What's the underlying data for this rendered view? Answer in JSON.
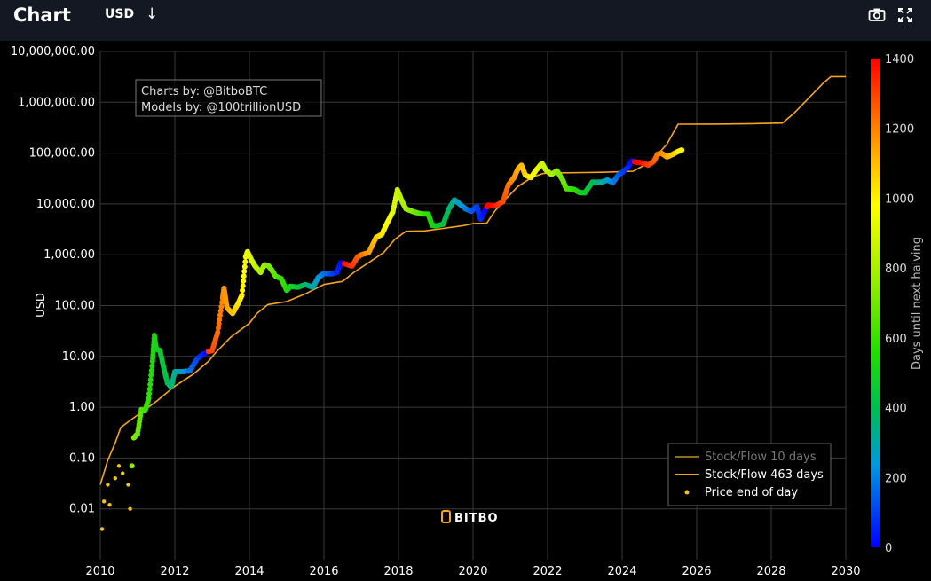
{
  "header": {
    "title": "Chart",
    "currency": "USD",
    "currency_arrow": "↓",
    "icons": [
      "camera-icon",
      "fullscreen-icon"
    ]
  },
  "credits": {
    "line1": "Charts by: @BitboBTC",
    "line2": "Models by: @100trillionUSD"
  },
  "watermark": "BITBO",
  "colors": {
    "background": "#000000",
    "topbar": "#141823",
    "grid": "#3a3a3a",
    "sf10": "#8a6d1f",
    "sf463": "#f7a51c",
    "price_dot": "#f7c21c"
  },
  "chart_data": {
    "type": "scatter",
    "ylabel": "USD",
    "yscale": "log",
    "ylim": [
      0.001,
      10000000
    ],
    "xlim": [
      2010,
      2030
    ],
    "y_ticks": [
      {
        "v": 10000000,
        "label": "10,000,000.00"
      },
      {
        "v": 1000000,
        "label": "1,000,000.00"
      },
      {
        "v": 100000,
        "label": "100,000.00"
      },
      {
        "v": 10000,
        "label": "10,000.00"
      },
      {
        "v": 1000,
        "label": "1,000.00"
      },
      {
        "v": 100,
        "label": "100.00"
      },
      {
        "v": 10,
        "label": "10.00"
      },
      {
        "v": 1,
        "label": "1.00"
      },
      {
        "v": 0.1,
        "label": "0.10"
      },
      {
        "v": 0.01,
        "label": "0.01"
      }
    ],
    "x_ticks": [
      "2010",
      "2012",
      "2014",
      "2016",
      "2018",
      "2020",
      "2022",
      "2024",
      "2026",
      "2028",
      "2030"
    ],
    "colorbar": {
      "label": "Days until next halving",
      "min": 0,
      "max": 1400,
      "ticks": [
        "0",
        "200",
        "400",
        "600",
        "800",
        "1000",
        "1200",
        "1400"
      ]
    },
    "legend": {
      "position": "bottom-right",
      "items": [
        {
          "name": "Stock/Flow 10 days",
          "kind": "line-dim"
        },
        {
          "name": "Stock/Flow 463 days",
          "kind": "line"
        },
        {
          "name": "Price end of day",
          "kind": "dot"
        }
      ]
    },
    "halvings": [
      2009.0,
      2012.9,
      2016.53,
      2020.37,
      2024.31,
      2028.3,
      2032.3
    ],
    "series": [
      {
        "name": "Stock/Flow 463 days",
        "points": [
          [
            2010.0,
            0.03
          ],
          [
            2010.2,
            0.09
          ],
          [
            2010.4,
            0.2
          ],
          [
            2010.55,
            0.4
          ],
          [
            2010.8,
            0.55
          ],
          [
            2011.0,
            0.7
          ],
          [
            2011.5,
            1.3
          ],
          [
            2012.0,
            2.6
          ],
          [
            2012.5,
            4.5
          ],
          [
            2012.9,
            8
          ],
          [
            2013.1,
            12
          ],
          [
            2013.5,
            24
          ],
          [
            2014.0,
            45
          ],
          [
            2014.2,
            70
          ],
          [
            2014.5,
            105
          ],
          [
            2015.0,
            120
          ],
          [
            2015.5,
            170
          ],
          [
            2016.0,
            260
          ],
          [
            2016.5,
            300
          ],
          [
            2016.8,
            450
          ],
          [
            2017.2,
            700
          ],
          [
            2017.6,
            1100
          ],
          [
            2017.9,
            2000
          ],
          [
            2018.2,
            2900
          ],
          [
            2018.7,
            2950
          ],
          [
            2019.2,
            3300
          ],
          [
            2019.7,
            3700
          ],
          [
            2020.0,
            4100
          ],
          [
            2020.37,
            4200
          ],
          [
            2020.6,
            7500
          ],
          [
            2020.9,
            13000
          ],
          [
            2021.2,
            22000
          ],
          [
            2021.6,
            34000
          ],
          [
            2021.9,
            40000
          ],
          [
            2022.4,
            41000
          ],
          [
            2023.0,
            41500
          ],
          [
            2023.5,
            42000
          ],
          [
            2024.3,
            44000
          ],
          [
            2024.8,
            70000
          ],
          [
            2025.2,
            150000
          ],
          [
            2025.5,
            370000
          ],
          [
            2026.5,
            372000
          ],
          [
            2027.5,
            380000
          ],
          [
            2028.3,
            390000
          ],
          [
            2028.6,
            600000
          ],
          [
            2029.0,
            1200000
          ],
          [
            2029.4,
            2400000
          ],
          [
            2029.6,
            3200000
          ],
          [
            2030.0,
            3200000
          ]
        ]
      },
      {
        "name": "Price end of day",
        "points": [
          [
            2010.05,
            0.004
          ],
          [
            2010.1,
            0.014
          ],
          [
            2010.2,
            0.03
          ],
          [
            2010.25,
            0.012
          ],
          [
            2010.4,
            0.04
          ],
          [
            2010.5,
            0.07
          ],
          [
            2010.6,
            0.05
          ],
          [
            2010.75,
            0.03
          ],
          [
            2010.8,
            0.01
          ],
          [
            2010.85,
            0.07
          ],
          [
            2010.9,
            0.25
          ],
          [
            2011.0,
            0.3
          ],
          [
            2011.1,
            0.9
          ],
          [
            2011.2,
            0.85
          ],
          [
            2011.3,
            1.5
          ],
          [
            2011.4,
            8
          ],
          [
            2011.45,
            26
          ],
          [
            2011.5,
            14
          ],
          [
            2011.6,
            13
          ],
          [
            2011.7,
            6
          ],
          [
            2011.8,
            3
          ],
          [
            2011.9,
            2.5
          ],
          [
            2012.0,
            5
          ],
          [
            2012.2,
            5
          ],
          [
            2012.4,
            5.2
          ],
          [
            2012.6,
            9
          ],
          [
            2012.75,
            11
          ],
          [
            2012.9,
            12.5
          ],
          [
            2013.0,
            13
          ],
          [
            2013.15,
            30
          ],
          [
            2013.28,
            140
          ],
          [
            2013.32,
            220
          ],
          [
            2013.4,
            90
          ],
          [
            2013.55,
            70
          ],
          [
            2013.7,
            110
          ],
          [
            2013.8,
            160
          ],
          [
            2013.9,
            900
          ],
          [
            2013.95,
            1150
          ],
          [
            2014.05,
            800
          ],
          [
            2014.15,
            600
          ],
          [
            2014.3,
            450
          ],
          [
            2014.4,
            630
          ],
          [
            2014.5,
            620
          ],
          [
            2014.6,
            500
          ],
          [
            2014.7,
            380
          ],
          [
            2014.85,
            340
          ],
          [
            2015.0,
            200
          ],
          [
            2015.1,
            240
          ],
          [
            2015.3,
            230
          ],
          [
            2015.5,
            260
          ],
          [
            2015.7,
            230
          ],
          [
            2015.85,
            360
          ],
          [
            2016.0,
            430
          ],
          [
            2016.2,
            420
          ],
          [
            2016.35,
            450
          ],
          [
            2016.45,
            700
          ],
          [
            2016.6,
            650
          ],
          [
            2016.75,
            600
          ],
          [
            2016.9,
            900
          ],
          [
            2017.0,
            1000
          ],
          [
            2017.2,
            1100
          ],
          [
            2017.4,
            2200
          ],
          [
            2017.55,
            2500
          ],
          [
            2017.7,
            4300
          ],
          [
            2017.85,
            7000
          ],
          [
            2017.97,
            19000
          ],
          [
            2018.1,
            11000
          ],
          [
            2018.2,
            8000
          ],
          [
            2018.4,
            7000
          ],
          [
            2018.6,
            6400
          ],
          [
            2018.8,
            6300
          ],
          [
            2018.9,
            3800
          ],
          [
            2019.0,
            3700
          ],
          [
            2019.2,
            4000
          ],
          [
            2019.35,
            8000
          ],
          [
            2019.5,
            12000
          ],
          [
            2019.6,
            10500
          ],
          [
            2019.8,
            8000
          ],
          [
            2019.95,
            7200
          ],
          [
            2020.1,
            9000
          ],
          [
            2020.2,
            5000
          ],
          [
            2020.3,
            7000
          ],
          [
            2020.4,
            9500
          ],
          [
            2020.6,
            9200
          ],
          [
            2020.8,
            11000
          ],
          [
            2020.95,
            24000
          ],
          [
            2021.1,
            33000
          ],
          [
            2021.2,
            48000
          ],
          [
            2021.3,
            58000
          ],
          [
            2021.4,
            37000
          ],
          [
            2021.55,
            33000
          ],
          [
            2021.7,
            47000
          ],
          [
            2021.85,
            63000
          ],
          [
            2021.95,
            47000
          ],
          [
            2022.1,
            38000
          ],
          [
            2022.25,
            45000
          ],
          [
            2022.4,
            30000
          ],
          [
            2022.5,
            20000
          ],
          [
            2022.7,
            19500
          ],
          [
            2022.85,
            16800
          ],
          [
            2023.0,
            16500
          ],
          [
            2023.2,
            27000
          ],
          [
            2023.45,
            27000
          ],
          [
            2023.6,
            29500
          ],
          [
            2023.75,
            26500
          ],
          [
            2023.9,
            37000
          ],
          [
            2024.0,
            42000
          ],
          [
            2024.15,
            52000
          ],
          [
            2024.25,
            70000
          ],
          [
            2024.4,
            66000
          ],
          [
            2024.55,
            64000
          ],
          [
            2024.7,
            58000
          ],
          [
            2024.85,
            69000
          ],
          [
            2024.95,
            95000
          ],
          [
            2025.05,
            100000
          ],
          [
            2025.2,
            84000
          ],
          [
            2025.35,
            94000
          ],
          [
            2025.5,
            108000
          ],
          [
            2025.6,
            115000
          ]
        ]
      }
    ]
  }
}
